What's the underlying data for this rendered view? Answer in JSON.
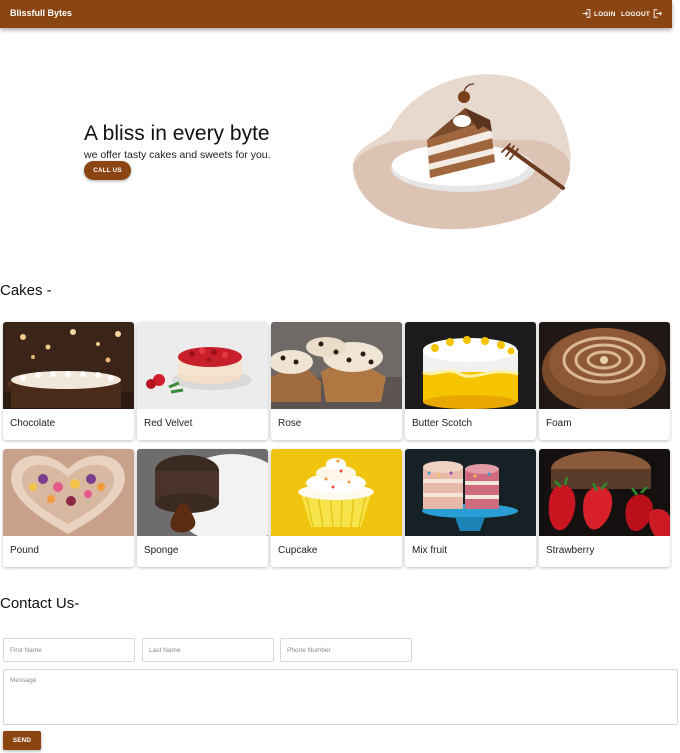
{
  "appbar": {
    "brand": "Blissfull Bytes",
    "login_label": "LOGIN",
    "logout_label": "LOGOUT",
    "color": "#8b4513"
  },
  "hero": {
    "title": "A bliss in every byte",
    "subtitle": "we offer tasty cakes and sweets for you.",
    "cta_label": "CALL US",
    "illustration": "cake-slice-illustration"
  },
  "cakes": {
    "heading": "Cakes -",
    "items": [
      {
        "label": "Chocolate"
      },
      {
        "label": "Red Velvet"
      },
      {
        "label": "Rose"
      },
      {
        "label": "Butter Scotch"
      },
      {
        "label": "Foam"
      },
      {
        "label": "Pound"
      },
      {
        "label": "Sponge"
      },
      {
        "label": "Cupcake"
      },
      {
        "label": "Mix fruit"
      },
      {
        "label": "Strawberry"
      }
    ]
  },
  "contact": {
    "heading": "Contact Us-",
    "first_name_placeholder": "First Name",
    "last_name_placeholder": "Last Name",
    "phone_placeholder": "Phone Number",
    "message_placeholder": "Message",
    "send_label": "SEND"
  }
}
